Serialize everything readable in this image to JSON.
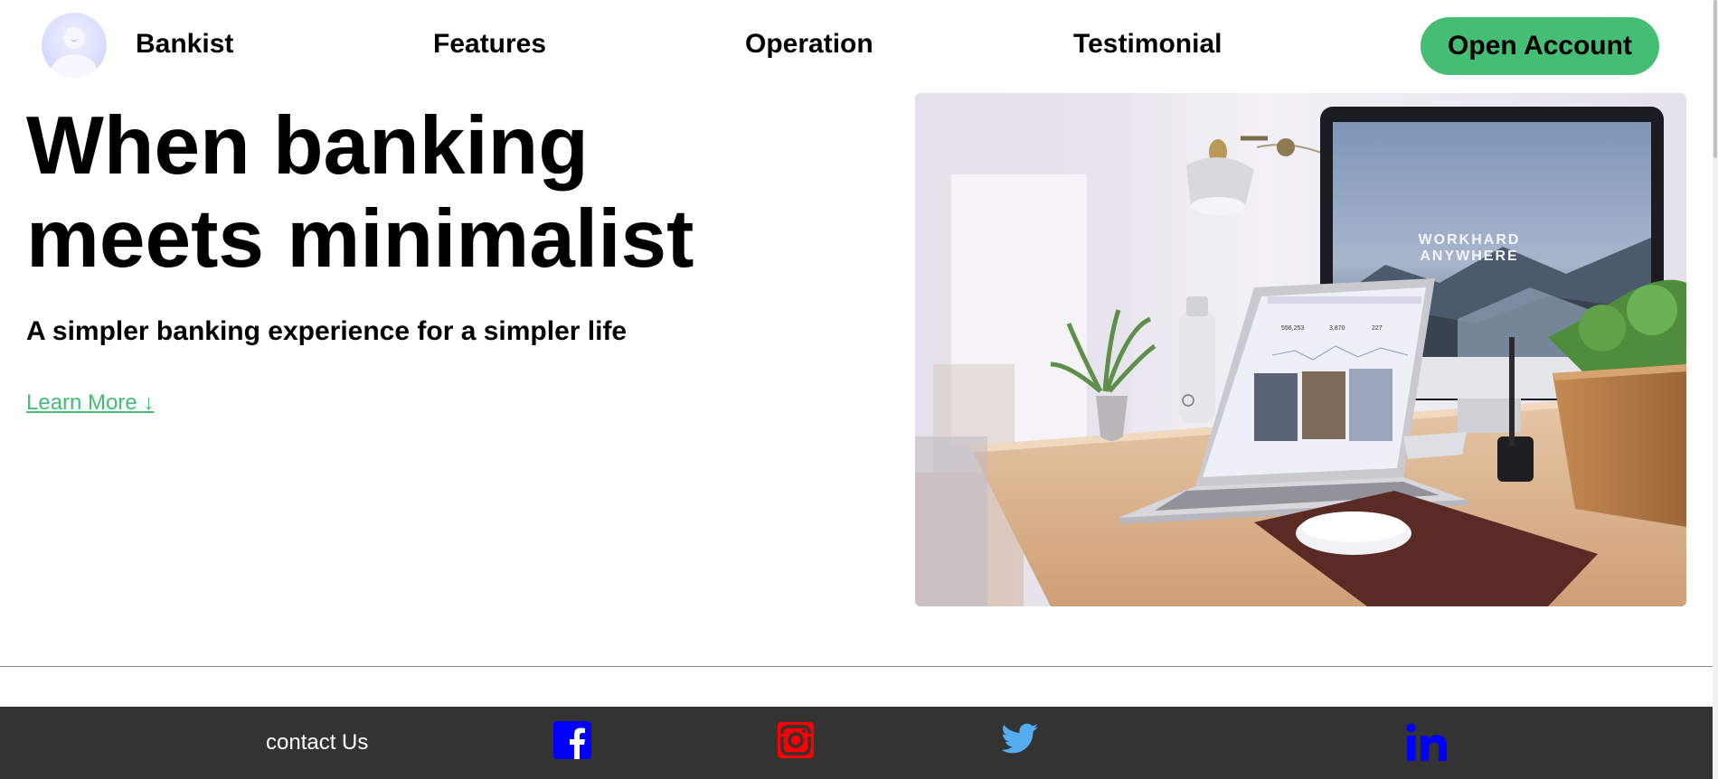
{
  "nav": {
    "brand": "Bankist",
    "links": [
      "Features",
      "Operation",
      "Testimonial"
    ],
    "cta": "Open Account"
  },
  "hero": {
    "title_line1": "When banking",
    "title_line2": "meets minimalist",
    "subtitle": "A simpler banking experience for a simpler life",
    "learn_more": "Learn More ↓"
  },
  "monitor_screen": {
    "line1": "WORKHARD",
    "line2": "ANYWHERE"
  },
  "laptop_screen": {
    "stat1": "556,253",
    "stat2": "3,870",
    "stat3": "227"
  },
  "footer": {
    "contact": "contact Us",
    "icons": [
      "facebook-icon",
      "instagram-icon",
      "twitter-icon",
      "linkedin-icon"
    ]
  },
  "colors": {
    "accent": "#45bd75",
    "footer_bg": "#333333",
    "facebook": "#0000ff",
    "instagram": "#ff0000",
    "twitter": "#55acee",
    "linkedin": "#0000ff"
  }
}
